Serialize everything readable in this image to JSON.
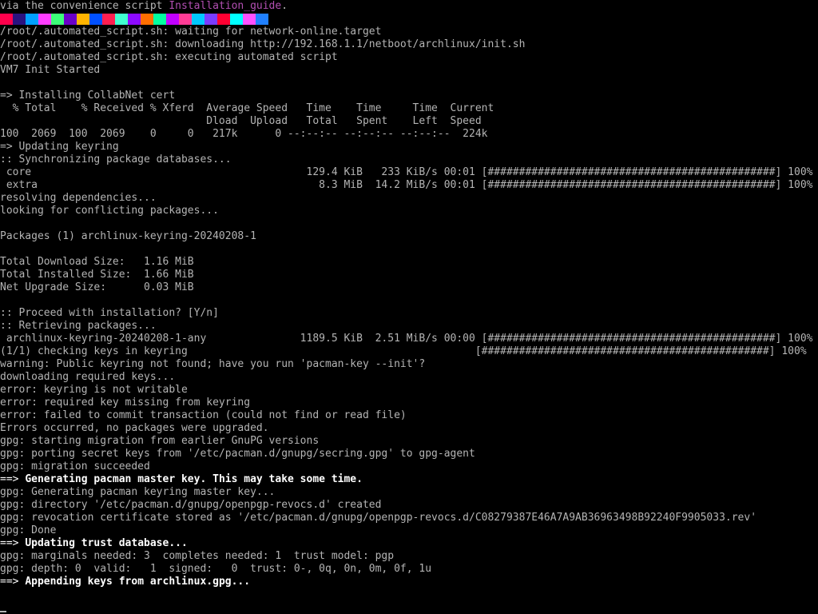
{
  "colors": {
    "background": "#000000",
    "text": "#b4b4b4",
    "bright": "#ffffff",
    "link": "#b24fb2"
  },
  "color_bar": [
    "#ff004c",
    "#2a1280",
    "#00a0ff",
    "#ff3cff",
    "#3cff78",
    "#6a00c8",
    "#ffb400",
    "#0050ff",
    "#ff1e50",
    "#40ffd0",
    "#8c0aff",
    "#ff6e00",
    "#00ffa0",
    "#c000ff",
    "#ff3c96",
    "#00c8ff",
    "#7a3cff",
    "#ff0032",
    "#00ffff",
    "#ff50ff",
    "#2080ff"
  ],
  "lines": [
    [
      {
        "t": "via the convenience script "
      },
      {
        "t": "Installation_guide",
        "c": "seg-link"
      },
      {
        "t": "."
      }
    ],
    "__COLORBAR__",
    [
      {
        "t": "/root/.automated_script.sh: waiting for network-online.target"
      }
    ],
    [
      {
        "t": "/root/.automated_script.sh: downloading http://192.168.1.1/netboot/archlinux/init.sh"
      }
    ],
    [
      {
        "t": "/root/.automated_script.sh: executing automated script"
      }
    ],
    [
      {
        "t": "VM7 Init Started"
      }
    ],
    [
      {
        "t": ""
      }
    ],
    [
      {
        "t": "=> Installing CollabNet cert"
      }
    ],
    [
      {
        "t": "  % Total    % Received % Xferd  Average Speed   Time    Time     Time  Current"
      }
    ],
    [
      {
        "t": "                                 Dload  Upload   Total   Spent    Left  Speed"
      }
    ],
    [
      {
        "t": "100  2069  100  2069    0     0   217k      0 --:--:-- --:--:-- --:--:--  224k"
      }
    ],
    [
      {
        "t": "=> Updating keyring"
      }
    ],
    [
      {
        "t": ":: Synchronizing package databases..."
      }
    ],
    [
      {
        "t": " core                                            129.4 KiB   233 KiB/s 00:01 [##############################################] 100%"
      }
    ],
    [
      {
        "t": " extra                                             8.3 MiB  14.2 MiB/s 00:01 [##############################################] 100%"
      }
    ],
    [
      {
        "t": "resolving dependencies..."
      }
    ],
    [
      {
        "t": "looking for conflicting packages..."
      }
    ],
    [
      {
        "t": ""
      }
    ],
    [
      {
        "t": "Packages (1) archlinux-keyring-20240208-1"
      }
    ],
    [
      {
        "t": ""
      }
    ],
    [
      {
        "t": "Total Download Size:   1.16 MiB"
      }
    ],
    [
      {
        "t": "Total Installed Size:  1.66 MiB"
      }
    ],
    [
      {
        "t": "Net Upgrade Size:      0.03 MiB"
      }
    ],
    [
      {
        "t": ""
      }
    ],
    [
      {
        "t": ":: Proceed with installation? [Y/n]"
      }
    ],
    [
      {
        "t": ":: Retrieving packages..."
      }
    ],
    [
      {
        "t": " archlinux-keyring-20240208-1-any               1189.5 KiB  2.51 MiB/s 00:00 [##############################################] 100%"
      }
    ],
    [
      {
        "t": "(1/1) checking keys in keyring                                              [##############################################] 100%"
      }
    ],
    [
      {
        "t": "warning: Public keyring not found; have you run 'pacman-key --init'?"
      }
    ],
    [
      {
        "t": "downloading required keys..."
      }
    ],
    [
      {
        "t": "error: keyring is not writable"
      }
    ],
    [
      {
        "t": "error: required key missing from keyring"
      }
    ],
    [
      {
        "t": "error: failed to commit transaction (could not find or read file)"
      }
    ],
    [
      {
        "t": "Errors occurred, no packages were upgraded."
      }
    ],
    [
      {
        "t": "gpg: starting migration from earlier GnuPG versions"
      }
    ],
    [
      {
        "t": "gpg: porting secret keys from '/etc/pacman.d/gnupg/secring.gpg' to gpg-agent"
      }
    ],
    [
      {
        "t": "gpg: migration succeeded"
      }
    ],
    [
      {
        "t": "==> ",
        "c": "seg-arrow"
      },
      {
        "t": "Generating pacman master key. This may take some time.",
        "c": "seg-bold"
      }
    ],
    [
      {
        "t": "gpg: Generating pacman keyring master key..."
      }
    ],
    [
      {
        "t": "gpg: directory '/etc/pacman.d/gnupg/openpgp-revocs.d' created"
      }
    ],
    [
      {
        "t": "gpg: revocation certificate stored as '/etc/pacman.d/gnupg/openpgp-revocs.d/C08279387E46A7A9AB36963498B92240F9905033.rev'"
      }
    ],
    [
      {
        "t": "gpg: Done"
      }
    ],
    [
      {
        "t": "==> ",
        "c": "seg-arrow"
      },
      {
        "t": "Updating trust database...",
        "c": "seg-bold"
      }
    ],
    [
      {
        "t": "gpg: marginals needed: 3  completes needed: 1  trust model: pgp"
      }
    ],
    [
      {
        "t": "gpg: depth: 0  valid:   1  signed:   0  trust: 0-, 0q, 0n, 0m, 0f, 1u"
      }
    ],
    [
      {
        "t": "==> ",
        "c": "seg-arrow"
      },
      {
        "t": "Appending keys from archlinux.gpg...",
        "c": "seg-bold"
      }
    ]
  ]
}
